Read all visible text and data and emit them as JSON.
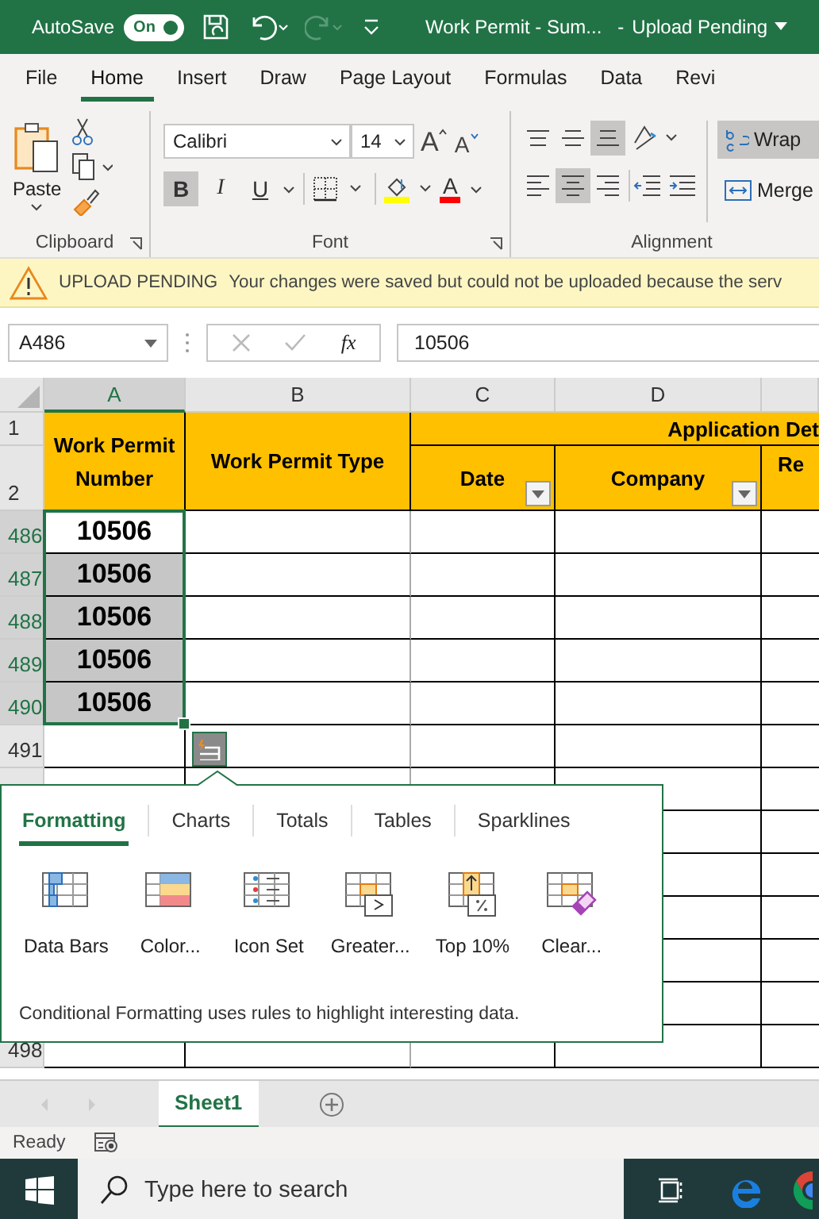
{
  "title_bar": {
    "autosave_label": "AutoSave",
    "autosave": {
      "label": "On",
      "on": true
    },
    "redo_disabled": true,
    "document_title": "Work Permit - Sum...",
    "separator": "-",
    "status": "Upload Pending"
  },
  "ribbon_tabs": [
    {
      "label": "File",
      "selected": false
    },
    {
      "label": "Home",
      "selected": true
    },
    {
      "label": "Insert",
      "selected": false
    },
    {
      "label": "Draw",
      "selected": false
    },
    {
      "label": "Page Layout",
      "selected": false
    },
    {
      "label": "Formulas",
      "selected": false
    },
    {
      "label": "Data",
      "selected": false
    },
    {
      "label": "Revi",
      "selected": false
    }
  ],
  "ribbon": {
    "clipboard": {
      "paste": "Paste",
      "group": "Clipboard"
    },
    "font": {
      "name": "Calibri",
      "size": "14",
      "grow": "A",
      "shrink": "A",
      "bold_label": "B",
      "italic_label": "I",
      "underline_label": "U",
      "font_color_label": "A",
      "bold": true,
      "italic": false,
      "underline": false,
      "group": "Font"
    },
    "alignment": {
      "vertical": [
        {
          "kind": "top",
          "selected": false
        },
        {
          "kind": "middle",
          "selected": false
        },
        {
          "kind": "bottom",
          "selected": true
        }
      ],
      "horizontal": [
        {
          "kind": "left",
          "selected": false
        },
        {
          "kind": "center",
          "selected": true
        },
        {
          "kind": "right",
          "selected": false
        }
      ],
      "wrap_text": {
        "label": "Wrap",
        "selected": true
      },
      "merge": "Merge",
      "group": "Alignment"
    }
  },
  "message_bar": {
    "title": "UPLOAD PENDING",
    "text": "Your changes were saved but could not be uploaded because the serv"
  },
  "formula_bar": {
    "name_box": "A486",
    "insert_function": "fx",
    "formula": "10506"
  },
  "sheet": {
    "columns": [
      {
        "label": "A",
        "selected": true
      },
      {
        "label": "B",
        "selected": false
      },
      {
        "label": "C",
        "selected": false
      },
      {
        "label": "D",
        "selected": false
      }
    ],
    "header": {
      "row_numbers": [
        "1",
        "2"
      ],
      "work_permit_number": "Work Permit Number",
      "work_permit_type": "Work Permit Type",
      "group_heading": "Application Det",
      "date": "Date",
      "company": "Company",
      "column_e": "Re"
    },
    "rows": [
      {
        "kind": "numbered",
        "number": "486",
        "value": "10506",
        "selected": true,
        "active": true
      },
      {
        "kind": "numbered",
        "number": "487",
        "value": "10506",
        "selected": true,
        "active": false
      },
      {
        "kind": "numbered",
        "number": "488",
        "value": "10506",
        "selected": true,
        "active": false
      },
      {
        "kind": "numbered",
        "number": "489",
        "value": "10506",
        "selected": true,
        "active": false
      },
      {
        "kind": "numbered",
        "number": "490",
        "value": "10506",
        "selected": true,
        "active": false
      },
      {
        "kind": "numbered",
        "number": "491",
        "selected": false
      },
      {
        "kind": "covered"
      },
      {
        "kind": "covered"
      },
      {
        "kind": "covered"
      },
      {
        "kind": "covered"
      },
      {
        "kind": "covered"
      },
      {
        "kind": "covered"
      },
      {
        "kind": "numbered",
        "number": "498",
        "selected": false
      }
    ]
  },
  "quick_analysis": {
    "tabs": [
      {
        "label": "Formatting",
        "selected": true
      },
      {
        "label": "Charts",
        "selected": false
      },
      {
        "label": "Totals",
        "selected": false
      },
      {
        "label": "Tables",
        "selected": false
      },
      {
        "label": "Sparklines",
        "selected": false
      }
    ],
    "tools": [
      {
        "label": "Data Bars",
        "kind": "data-bars"
      },
      {
        "label": "Color...",
        "kind": "color-scale"
      },
      {
        "label": "Icon Set",
        "kind": "icon-set"
      },
      {
        "label": "Greater...",
        "kind": "greater"
      },
      {
        "label": "Top 10%",
        "kind": "top"
      },
      {
        "label": "Clear...",
        "kind": "clear"
      }
    ],
    "description": "Conditional Formatting uses rules to highlight interesting data."
  },
  "sheet_tabs": [
    {
      "label": "Sheet1",
      "selected": true
    }
  ],
  "status_bar": {
    "text": "Ready"
  },
  "taskbar": {
    "search_placeholder": "Type here to search"
  }
}
